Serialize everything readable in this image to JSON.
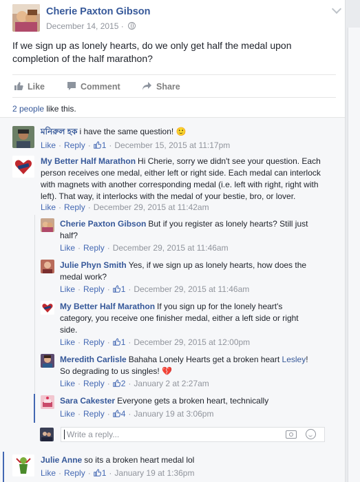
{
  "post": {
    "author": "Cherie Paxton Gibson",
    "date": "December 14, 2015",
    "date_separator": "·",
    "text": "If we sign up as lonely hearts, do we only get half the medal upon completion of the half marathon?"
  },
  "actions": {
    "like": "Like",
    "comment": "Comment",
    "share": "Share"
  },
  "likes": {
    "count_link": "2 people",
    "suffix": " like this."
  },
  "comment_actions": {
    "like": "Like",
    "reply": "Reply",
    "separator": "·"
  },
  "comments": [
    {
      "name": "মনিরুল হক",
      "text": "i have the same question! 🙂",
      "likes": "1",
      "time": "December 15, 2015 at 11:17pm"
    },
    {
      "name": "My Better Half Marathon",
      "text": "Hi Cherie, sorry we didn't see your question. Each person receives one medal, either left or right side. Each medal can interlock with magnets with another corresponding medal (i.e. left with right, right with left). That way, it interlocks with the medal of your bestie, bro, or lover.",
      "likes": "",
      "time": "December 29, 2015 at 11:42am"
    }
  ],
  "replies": [
    {
      "name": "Cherie Paxton Gibson",
      "text": "But if you register as lonely hearts? Still just half?",
      "likes": "",
      "time": "December 29, 2015 at 11:46am"
    },
    {
      "name": "Julie Phyn Smith",
      "text": "Yes, if we sign up as lonely hearts, how does the medal work?",
      "likes": "1",
      "time": "December 29, 2015 at 11:46am"
    },
    {
      "name": "My Better Half Marathon",
      "text": "If you sign up for the lonely heart's category, you receive one finisher medal, either a left side or right side.",
      "likes": "1",
      "time": "December 29, 2015 at 12:00pm"
    },
    {
      "name": "Meredith Carlisle",
      "text": "Bahaha Lonely Hearts get a broken heart",
      "mention": "Lesley",
      "text_after": "! So degrading to us singles! 💔",
      "likes": "2",
      "time": "January 2 at 2:27am"
    },
    {
      "name": "Sara Cakester",
      "text": "Everyone gets a broken heart, technically",
      "likes": "4",
      "time": "January 19 at 3:06pm"
    }
  ],
  "reply_box": {
    "placeholder": "Write a reply..."
  },
  "last_comment": {
    "name": "Julie Anne",
    "text": "so its a broken heart medal lol",
    "likes": "1",
    "time": "January 19 at 1:36pm"
  },
  "colors": {
    "link": "#365899",
    "meta": "#90949c",
    "accent": "#4267b2"
  }
}
